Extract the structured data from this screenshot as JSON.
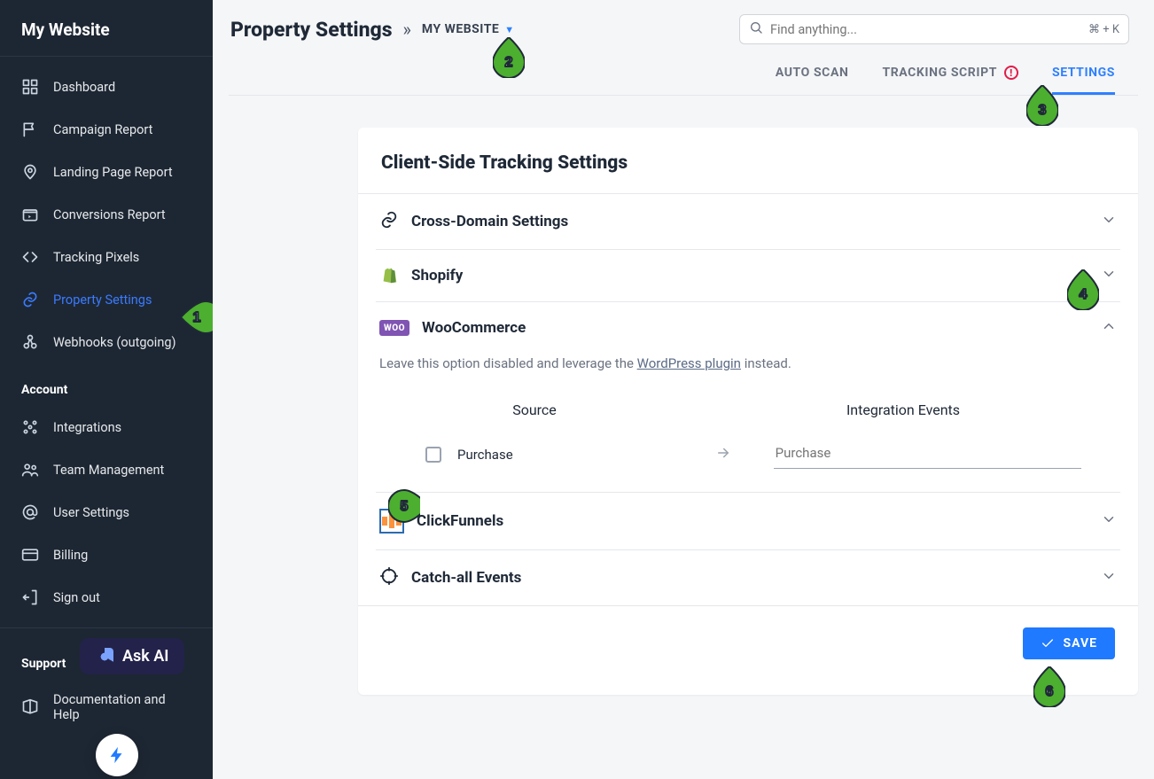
{
  "brand": "My Website",
  "sidebar": {
    "main": [
      {
        "label": "Dashboard"
      },
      {
        "label": "Campaign Report"
      },
      {
        "label": "Landing Page Report"
      },
      {
        "label": "Conversions Report"
      },
      {
        "label": "Tracking Pixels"
      },
      {
        "label": "Property Settings"
      },
      {
        "label": "Webhooks (outgoing)"
      }
    ],
    "account_title": "Account",
    "account": [
      {
        "label": "Integrations"
      },
      {
        "label": "Team Management"
      },
      {
        "label": "User Settings"
      },
      {
        "label": "Billing"
      },
      {
        "label": "Sign out"
      }
    ],
    "support_title": "Support",
    "support": [
      {
        "label": "Documentation and Help"
      }
    ]
  },
  "header": {
    "page_title": "Property Settings",
    "crumb_separator": "»",
    "property_name": "MY WEBSITE",
    "search_placeholder": "Find anything...",
    "search_shortcut": "⌘ + K"
  },
  "tabs": {
    "auto_scan": "AUTO SCAN",
    "tracking_script": "TRACKING SCRIPT",
    "tracking_script_warn": "!",
    "settings": "SETTINGS"
  },
  "card": {
    "title": "Client-Side Tracking Settings",
    "sections": {
      "cross_domain": "Cross-Domain Settings",
      "shopify": "Shopify",
      "woocommerce": "WooCommerce",
      "clickfunnels": "ClickFunnels",
      "catchall": "Catch-all Events"
    },
    "woo": {
      "hint_pre": "Leave this option disabled and leverage the ",
      "hint_link": "WordPress plugin",
      "hint_post": " instead.",
      "col_source": "Source",
      "col_events": "Integration Events",
      "row_source": "Purchase",
      "row_event_placeholder": "Purchase"
    },
    "save": "SAVE"
  },
  "ask_ai": "Ask AI",
  "badges": {
    "1": "1",
    "2": "2",
    "3": "3",
    "4": "4",
    "5": "5",
    "6": "6"
  }
}
